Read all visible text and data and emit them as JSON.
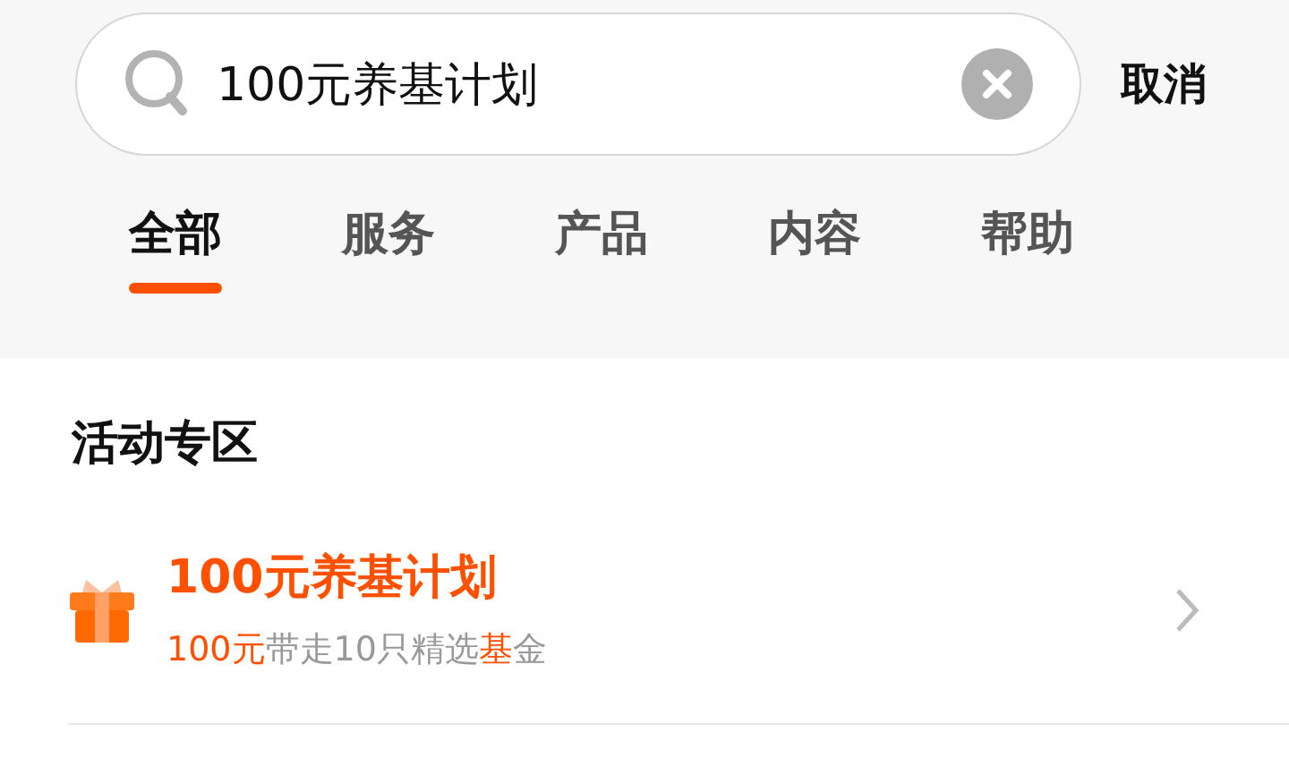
{
  "search": {
    "value": "100元养基计划",
    "cancel": "取消"
  },
  "tabs": [
    {
      "label": "全部",
      "selected": true
    },
    {
      "label": "服务",
      "selected": false
    },
    {
      "label": "产品",
      "selected": false
    },
    {
      "label": "内容",
      "selected": false
    },
    {
      "label": "帮助",
      "selected": false
    }
  ],
  "section": {
    "title": "活动专区",
    "items": [
      {
        "title": "100元养基计划",
        "subtitle": [
          {
            "text": "100元",
            "highlight": true
          },
          {
            "text": "带走10只精选",
            "highlight": false
          },
          {
            "text": "基",
            "highlight": true
          },
          {
            "text": "金",
            "highlight": false
          }
        ]
      }
    ]
  }
}
